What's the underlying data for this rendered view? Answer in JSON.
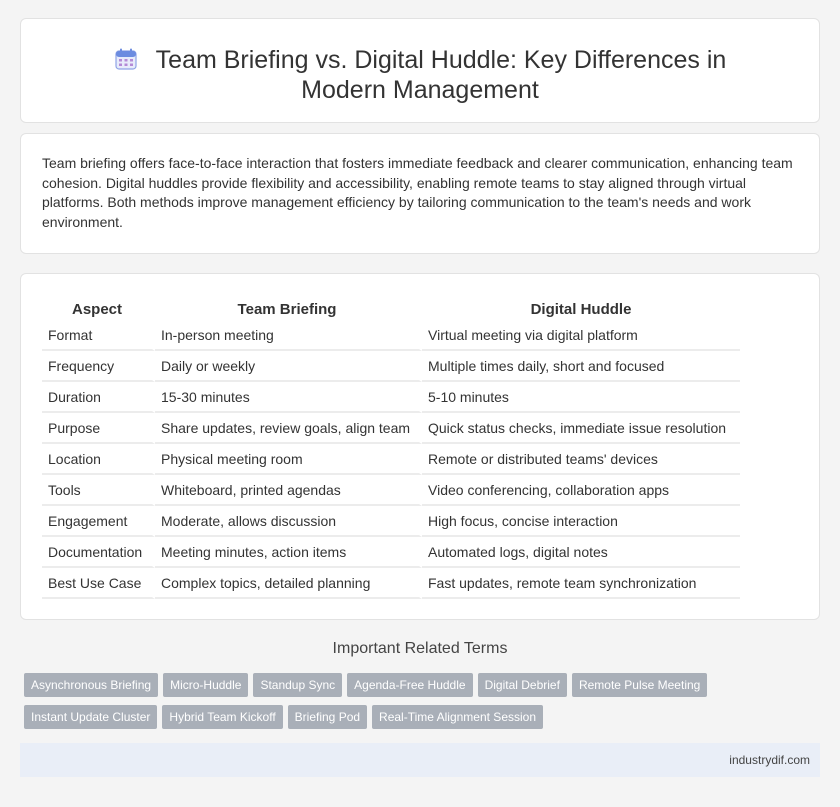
{
  "page": {
    "title": "Team Briefing vs. Digital Huddle: Key Differences in Modern Management",
    "title_icon": "calendar-icon"
  },
  "intro": "Team briefing offers face-to-face interaction that fosters immediate feedback and clearer communication, enhancing team cohesion. Digital huddles provide flexibility and accessibility, enabling remote teams to stay aligned through virtual platforms. Both methods improve management efficiency by tailoring communication to the team's needs and work environment.",
  "table": {
    "headers": [
      "Aspect",
      "Team Briefing",
      "Digital Huddle"
    ],
    "rows": [
      [
        "Format",
        "In-person meeting",
        "Virtual meeting via digital platform"
      ],
      [
        "Frequency",
        "Daily or weekly",
        "Multiple times daily, short and focused"
      ],
      [
        "Duration",
        "15-30 minutes",
        "5-10 minutes"
      ],
      [
        "Purpose",
        "Share updates, review goals, align team",
        "Quick status checks, immediate issue resolution"
      ],
      [
        "Location",
        "Physical meeting room",
        "Remote or distributed teams' devices"
      ],
      [
        "Tools",
        "Whiteboard, printed agendas",
        "Video conferencing, collaboration apps"
      ],
      [
        "Engagement",
        "Moderate, allows discussion",
        "High focus, concise interaction"
      ],
      [
        "Documentation",
        "Meeting minutes, action items",
        "Automated logs, digital notes"
      ],
      [
        "Best Use Case",
        "Complex topics, detailed planning",
        "Fast updates, remote team synchronization"
      ]
    ]
  },
  "related": {
    "title": "Important Related Terms",
    "row1": [
      "Asynchronous Briefing",
      "Micro-Huddle",
      "Standup Sync",
      "Agenda-Free Huddle",
      "Digital Debrief",
      "Remote Pulse Meeting"
    ],
    "row2": [
      "Instant Update Cluster",
      "Hybrid Team Kickoff",
      "Briefing Pod",
      "Real-Time Alignment Session"
    ]
  },
  "footer": {
    "source": "industrydif.com"
  },
  "colors": {
    "tag_bg": "#a9afb8",
    "footer_bg": "#e9eef7",
    "icon_accent": "#5b7fd6"
  }
}
